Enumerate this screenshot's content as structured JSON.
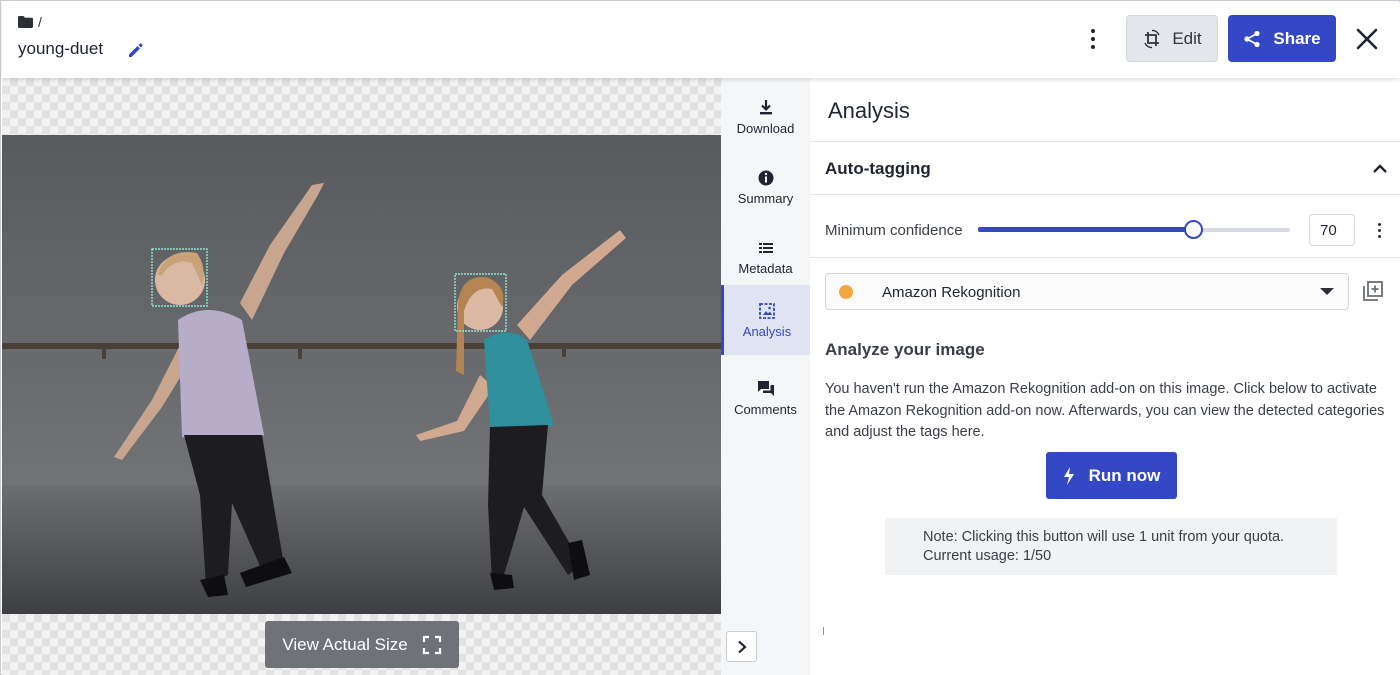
{
  "header": {
    "breadcrumb_separator": "/",
    "file_name": "young-duet",
    "edit_label": "Edit",
    "share_label": "Share"
  },
  "viewer": {
    "view_actual_size_label": "View Actual Size"
  },
  "rail": {
    "items": [
      {
        "label": "Download",
        "icon": "download-icon"
      },
      {
        "label": "Summary",
        "icon": "info-icon"
      },
      {
        "label": "Metadata",
        "icon": "list-icon"
      },
      {
        "label": "Analysis",
        "icon": "analysis-icon",
        "active": true
      },
      {
        "label": "Comments",
        "icon": "comments-icon"
      }
    ]
  },
  "panel": {
    "title": "Analysis",
    "section": "Auto-tagging",
    "min_confidence_label": "Minimum confidence",
    "min_confidence_value": "70",
    "slider_fraction": 0.69,
    "provider": {
      "name": "Amazon Rekognition",
      "color": "#f5a742"
    },
    "analyze_heading": "Analyze your image",
    "analyze_text": "You haven't run the Amazon Rekognition add-on on this image. Click below to activate the Amazon Rekognition add-on now. Afterwards, you can view the detected categories and adjust the tags here.",
    "run_label": "Run now",
    "note_line1": "Note: Clicking this button will use 1 unit from your quota.",
    "note_line2": "Current usage: 1/50"
  },
  "colors": {
    "accent": "#3448c5",
    "active_bg": "#e1e4f2"
  }
}
